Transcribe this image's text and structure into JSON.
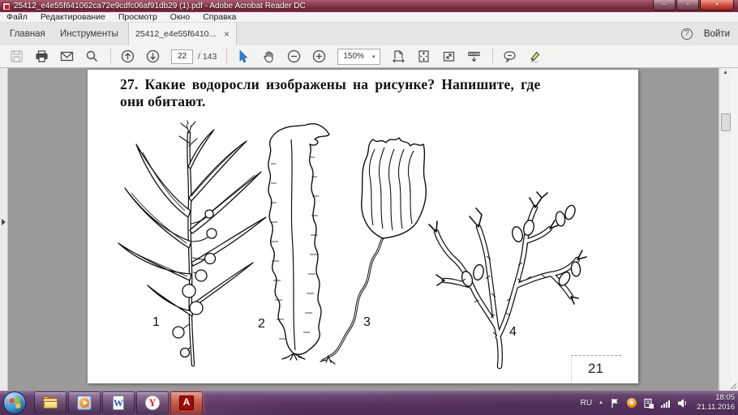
{
  "window": {
    "title": "25412_e4e55f641062ca72e9cdfc06af91db29 (1).pdf - Adobe Acrobat Reader DC"
  },
  "menu": {
    "items": [
      "Файл",
      "Редактирование",
      "Просмотр",
      "Окно",
      "Справка"
    ]
  },
  "tabs": {
    "home": "Главная",
    "tools": "Инструменты",
    "doc": "25412_e4e55f6410...",
    "doc_close": "×",
    "help": "?",
    "sign_in": "Войти"
  },
  "toolbar": {
    "page_current": "22",
    "page_total": "/ 143",
    "zoom_level": "150%",
    "zoom_caret": "▾"
  },
  "document": {
    "question_line1": "27. Какие водоросли изображены на рисунке? Напишите, где",
    "question_line2": "они обитают.",
    "figure_labels": [
      "1",
      "2",
      "3",
      "4"
    ],
    "page_number": "21"
  },
  "scrollbar": {
    "up_glyph": "▲"
  },
  "taskbar": {
    "word_letter": "W",
    "yandex_letter": "Y",
    "acrobat_letter": "A",
    "tray": {
      "language": "RU",
      "expand_glyph": "▲",
      "time": "18:05",
      "date": "21.11.2016"
    }
  },
  "icons": {
    "window_minimize": "–",
    "window_maximize": "▫",
    "window_close": "×"
  },
  "colors": {
    "titlebar": "#8a3a50",
    "taskbar": "#583463",
    "select_tool_blue": "#2a7fd4",
    "acrobat_red": "#9e0a00",
    "doc_background": "#9a9a9a",
    "toolbar_bg": "#f3f3f1"
  }
}
